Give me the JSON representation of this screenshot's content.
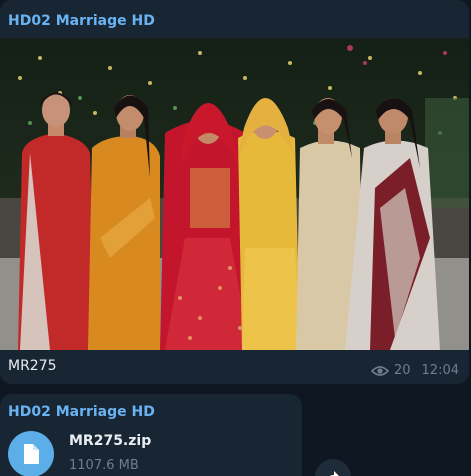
{
  "messages": [
    {
      "sender": "HD02 Marriage HD",
      "photo_caption": "MR275",
      "views": "20",
      "time": "12:04",
      "view_icon": "eye-icon"
    },
    {
      "sender": "HD02 Marriage HD",
      "file_name": "MR275.zip",
      "file_size": "1107.6 MB",
      "file_icon": "document-icon"
    }
  ],
  "forward_icon": "share-icon",
  "colors": {
    "background": "#0e1621",
    "bubble": "#182533",
    "sender": "#6ab3f3",
    "accent": "#5caee9",
    "meta": "#6d7f8f"
  }
}
